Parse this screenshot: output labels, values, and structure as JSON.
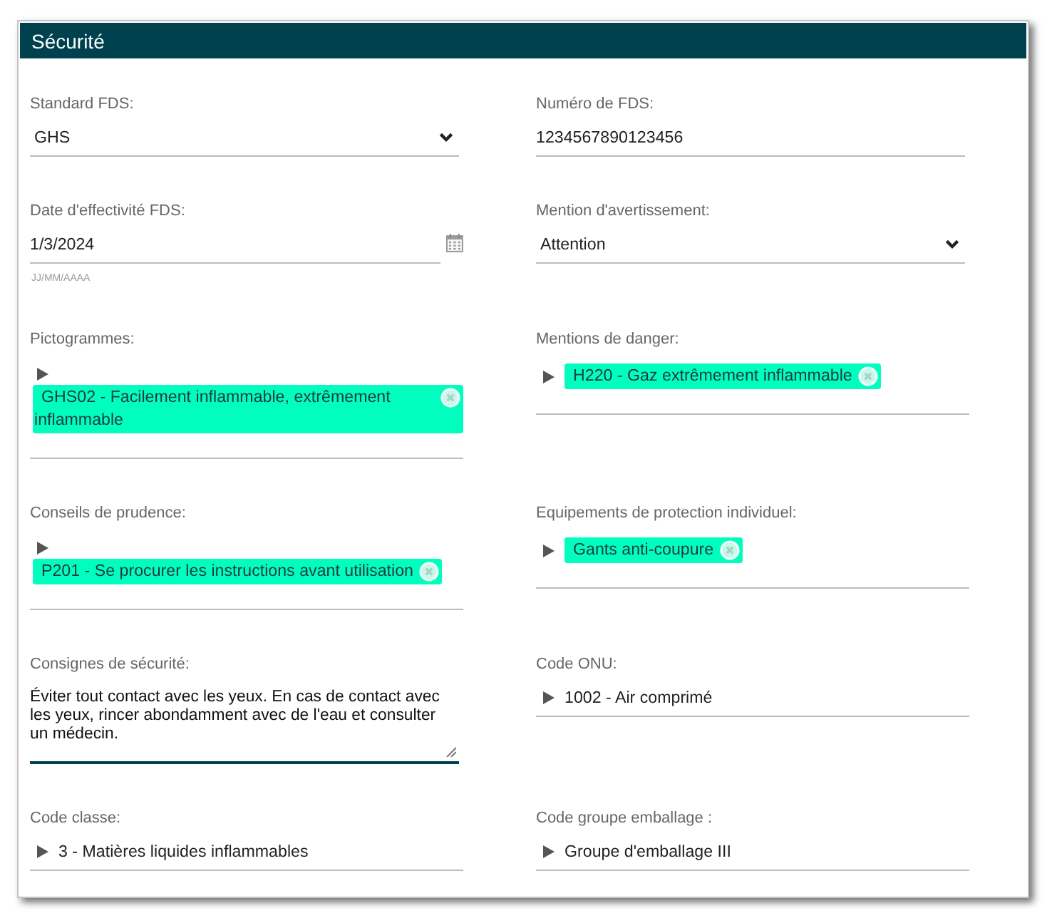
{
  "panel": {
    "title": "Sécurité"
  },
  "fields": [
    {
      "label": "Standard FDS:",
      "kind": "select",
      "value": "GHS",
      "focused": false
    },
    {
      "label": "Numéro de FDS:",
      "kind": "text",
      "value": "1234567890123456",
      "focused": false
    },
    {
      "label": "Date d'effectivité FDS:",
      "kind": "date",
      "value": "1/3/2024",
      "hint": "JJ/MM/AAAA",
      "focused": false
    },
    {
      "label": "Mention d'avertissement:",
      "kind": "select",
      "value": "Attention",
      "focused": false
    },
    {
      "label": "Pictogrammes:",
      "kind": "tags",
      "tags": [
        "GHS02 - Facilement inflammable, extrêmement inflammable"
      ],
      "focused": false
    },
    {
      "label": "Mentions de danger:",
      "kind": "tags",
      "tags": [
        "H220 - Gaz extrêmement inflammable"
      ],
      "focused": false
    },
    {
      "label": "Conseils de prudence:",
      "kind": "tags",
      "tags": [
        "P201 - Se procurer les instructions avant utilisation"
      ],
      "focused": false
    },
    {
      "label": "Equipements de protection individuel:",
      "kind": "tags",
      "tags": [
        "Gants anti-coupure"
      ],
      "focused": false
    },
    {
      "label": "Consignes de sécurité:",
      "kind": "textarea",
      "value": "Éviter tout contact avec les yeux. En cas de contact avec les yeux, rincer abondamment avec de l'eau et consulter un médecin.",
      "focused": true
    },
    {
      "label": "Code ONU:",
      "kind": "lookup",
      "value": "1002 - Air comprimé",
      "focused": false
    },
    {
      "label": "Code classe:",
      "kind": "lookup",
      "value": "3 - Matières liquides inflammables",
      "focused": false
    },
    {
      "label": "Code groupe emballage :",
      "kind": "lookup",
      "value": "Groupe d'emballage III",
      "focused": false
    }
  ]
}
